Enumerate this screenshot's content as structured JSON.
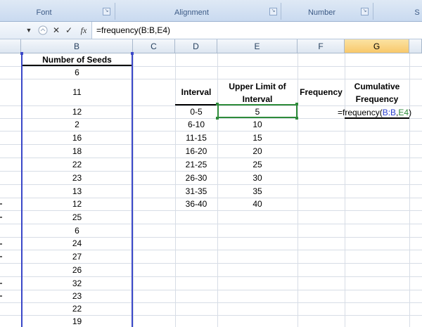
{
  "ribbon": {
    "groups": [
      "Font",
      "Alignment",
      "Number",
      "S"
    ]
  },
  "formula_bar": {
    "cancel_glyph": "✕",
    "enter_glyph": "✓",
    "fx_label": "fx",
    "formula": "=frequency(B:B,E4)"
  },
  "columns": [
    "B",
    "C",
    "D",
    "E",
    "F",
    "G"
  ],
  "selected_column": "G",
  "sheet": {
    "header_b": "Number of Seeds",
    "seeds": [
      "6",
      "11",
      "12",
      "2",
      "16",
      "18",
      "22",
      "23",
      "13",
      "12",
      "25",
      "6",
      "24",
      "27",
      "26",
      "32",
      "23",
      "22",
      "19"
    ],
    "header_d": "Interval",
    "header_e": "Upper Limit of Interval",
    "header_f": "Frequency",
    "header_g": "Cumulative Frequency",
    "intervals": [
      "0-5",
      "6-10",
      "11-15",
      "16-20",
      "21-25",
      "26-30",
      "31-35",
      "36-40"
    ],
    "upper_limits": [
      "5",
      "10",
      "15",
      "20",
      "25",
      "30",
      "35",
      "40"
    ],
    "edit_formula_prefix": "=frequency(",
    "edit_formula_ref1": "B:B",
    "edit_formula_comma": ",",
    "edit_formula_ref2": "E4",
    "edit_formula_suffix": ")"
  },
  "colors": {
    "ref1": "#2a3fcf",
    "ref2": "#2e8b3a",
    "selected_header": "#f8c86a"
  }
}
